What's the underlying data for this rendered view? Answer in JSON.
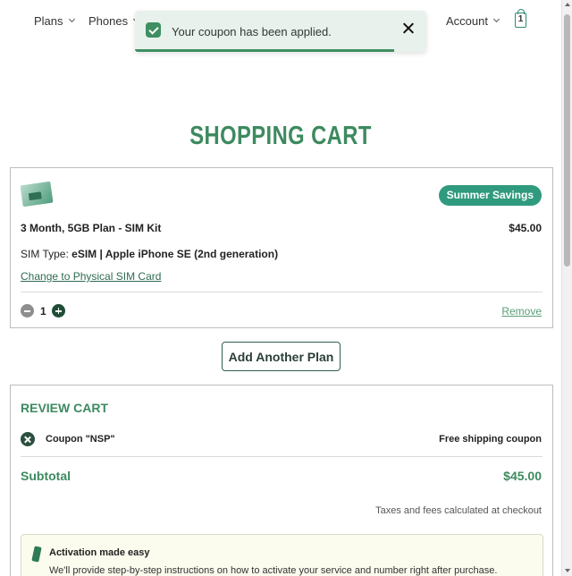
{
  "nav": {
    "plans": "Plans",
    "phones": "Phones",
    "account": "Account",
    "cart_count": "1"
  },
  "toast": {
    "message": "Your coupon has been applied.",
    "progress": 0.89,
    "icons": {
      "status": "check-icon",
      "close": "close-icon"
    }
  },
  "page": {
    "title": "SHOPPING CART"
  },
  "cart_item": {
    "badge": "Summer Savings",
    "name": "3 Month, 5GB Plan - SIM Kit",
    "price": "$45.00",
    "sim_type_label": "SIM Type: ",
    "sim_type_value": "eSIM | Apple iPhone SE (2nd generation)",
    "change_link": "Change to Physical SIM Card",
    "quantity": "1",
    "remove_label": "Remove"
  },
  "actions": {
    "add_plan": "Add Another Plan"
  },
  "review": {
    "title": "REVIEW CART",
    "coupon_label": "Coupon \"NSP\"",
    "coupon_value": "Free shipping coupon",
    "subtotal_label": "Subtotal",
    "subtotal_value": "$45.00",
    "tax_note": "Taxes and fees calculated at checkout",
    "activation_title": "Activation made easy",
    "activation_text": "We'll provide step-by-step instructions on how to activate your service and number right after purchase."
  },
  "colors": {
    "brand_green": "#3d8a5f",
    "badge_teal": "#2f9a7e",
    "toast_bg": "#e8f1ec"
  }
}
